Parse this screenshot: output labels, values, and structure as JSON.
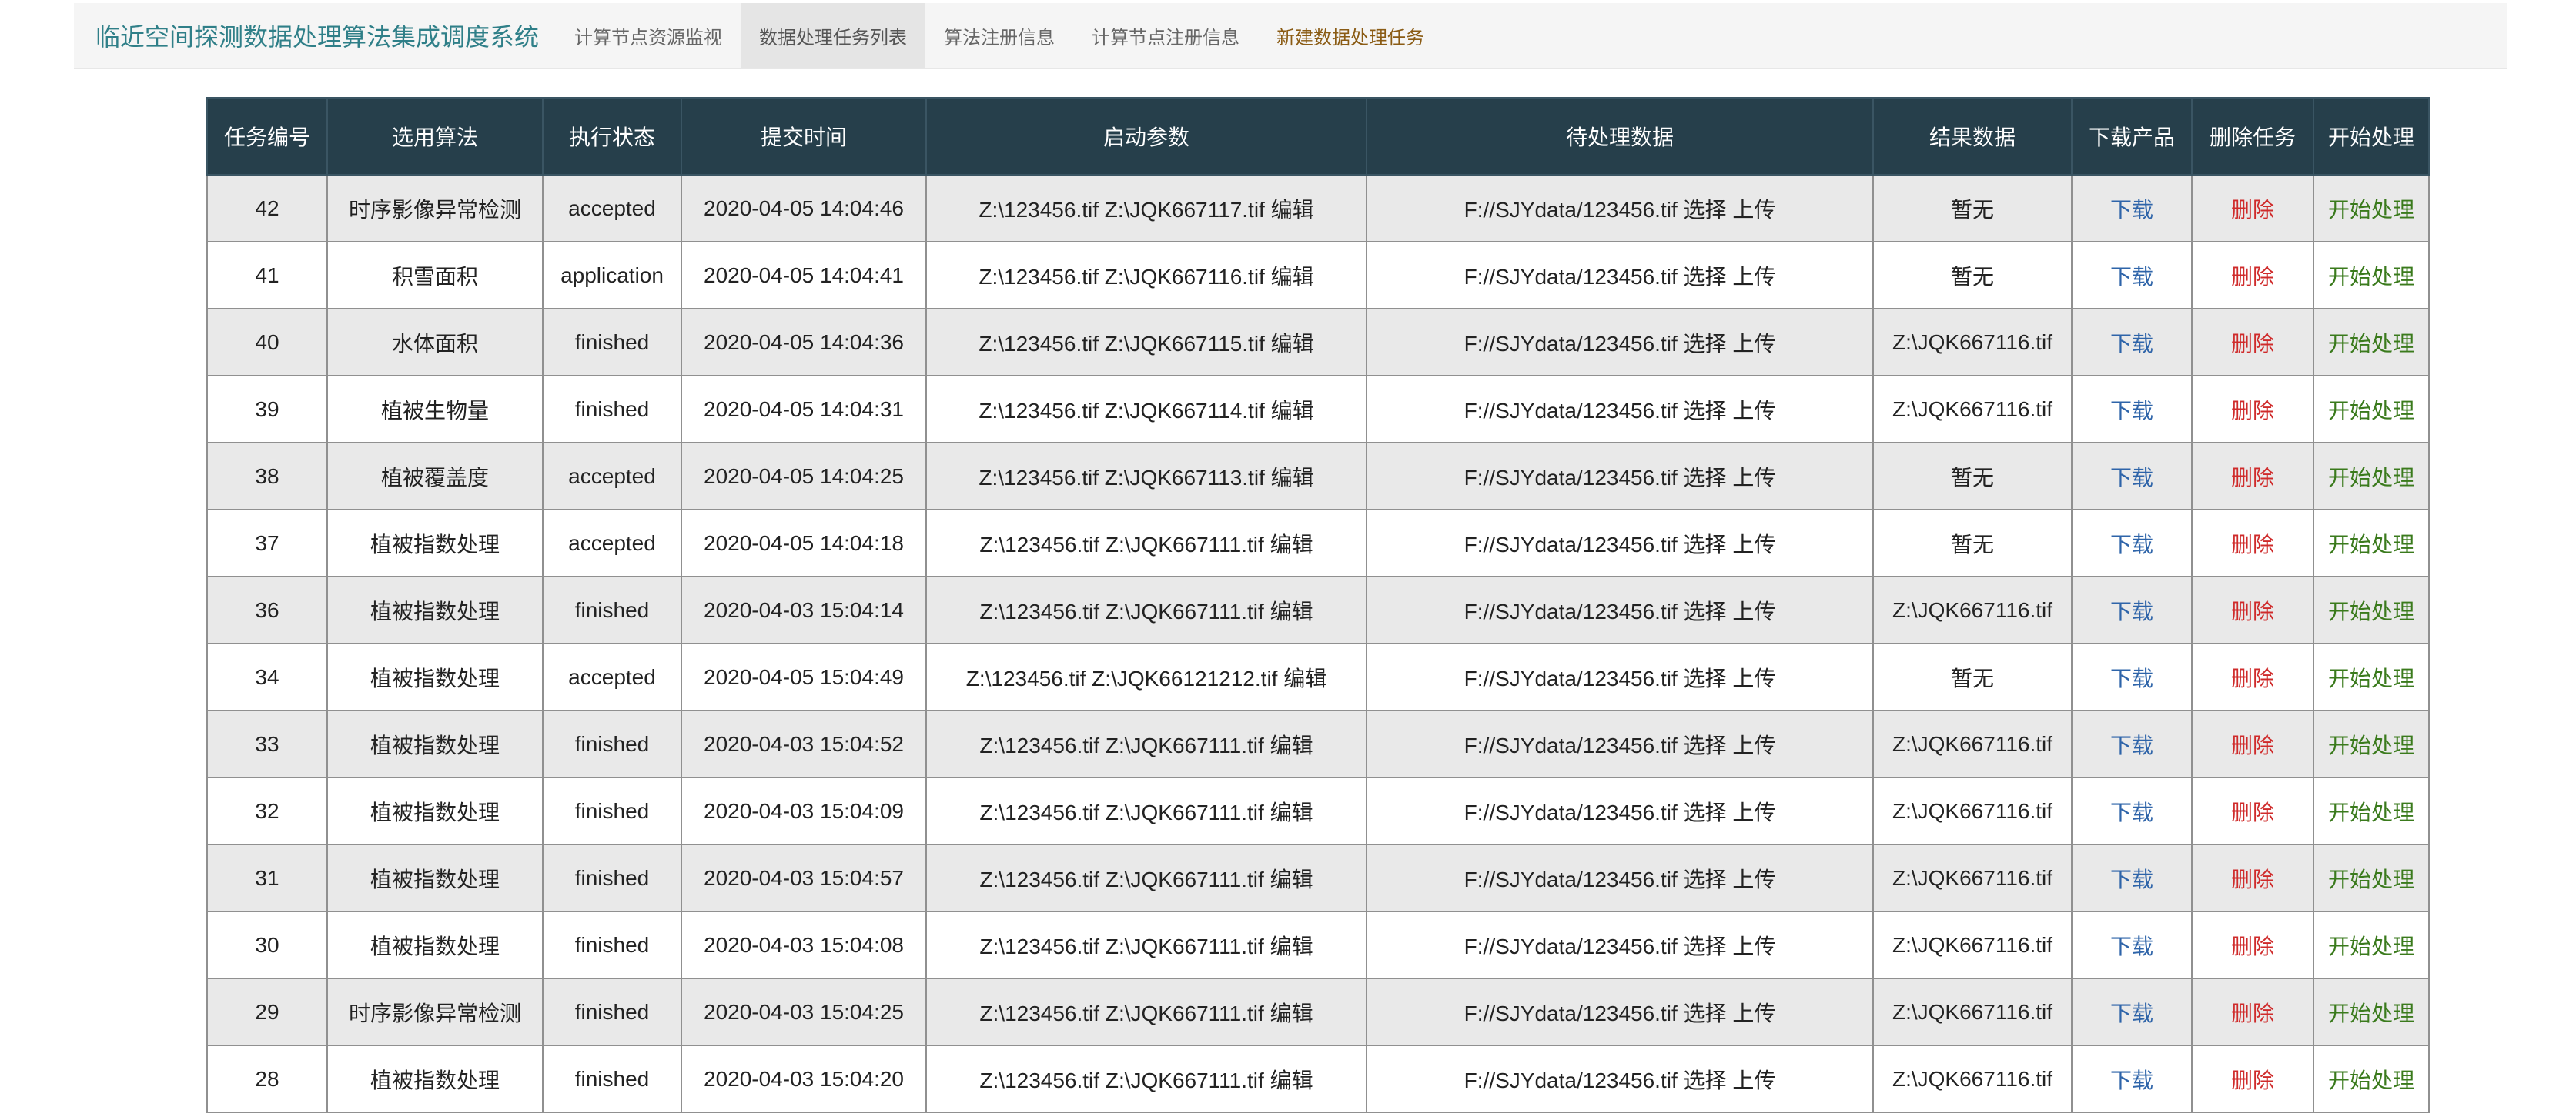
{
  "navbar": {
    "brand": "临近空间探测数据处理算法集成调度系统",
    "links": [
      {
        "label": "计算节点资源监视"
      },
      {
        "label": "数据处理任务列表"
      },
      {
        "label": "算法注册信息"
      },
      {
        "label": "计算节点注册信息"
      },
      {
        "label": "新建数据处理任务"
      }
    ]
  },
  "table": {
    "headers": [
      "任务编号",
      "选用算法",
      "执行状态",
      "提交时间",
      "启动参数",
      "待处理数据",
      "结果数据",
      "下载产品",
      "删除任务",
      "开始处理"
    ],
    "actions": {
      "edit": "编辑",
      "select": "选择",
      "upload": "上传",
      "download": "下载",
      "delete": "删除",
      "start": "开始处理"
    },
    "rows": [
      {
        "id": "42",
        "algorithm": "时序影像异常检测",
        "status": "accepted",
        "time": "2020-04-05 14:04:46",
        "params": "Z:\\123456.tif Z:\\JQK667117.tif",
        "input": "F://SJYdata/123456.tif",
        "result": "暂无"
      },
      {
        "id": "41",
        "algorithm": "积雪面积",
        "status": "application",
        "time": "2020-04-05 14:04:41",
        "params": "Z:\\123456.tif Z:\\JQK667116.tif",
        "input": "F://SJYdata/123456.tif",
        "result": "暂无"
      },
      {
        "id": "40",
        "algorithm": "水体面积",
        "status": "finished",
        "time": "2020-04-05 14:04:36",
        "params": "Z:\\123456.tif Z:\\JQK667115.tif",
        "input": "F://SJYdata/123456.tif",
        "result": "Z:\\JQK667116.tif"
      },
      {
        "id": "39",
        "algorithm": "植被生物量",
        "status": "finished",
        "time": "2020-04-05 14:04:31",
        "params": "Z:\\123456.tif Z:\\JQK667114.tif",
        "input": "F://SJYdata/123456.tif",
        "result": "Z:\\JQK667116.tif"
      },
      {
        "id": "38",
        "algorithm": "植被覆盖度",
        "status": "accepted",
        "time": "2020-04-05 14:04:25",
        "params": "Z:\\123456.tif Z:\\JQK667113.tif",
        "input": "F://SJYdata/123456.tif",
        "result": "暂无"
      },
      {
        "id": "37",
        "algorithm": "植被指数处理",
        "status": "accepted",
        "time": "2020-04-05 14:04:18",
        "params": "Z:\\123456.tif Z:\\JQK667111.tif",
        "input": "F://SJYdata/123456.tif",
        "result": "暂无"
      },
      {
        "id": "36",
        "algorithm": "植被指数处理",
        "status": "finished",
        "time": "2020-04-03 15:04:14",
        "params": "Z:\\123456.tif Z:\\JQK667111.tif",
        "input": "F://SJYdata/123456.tif",
        "result": "Z:\\JQK667116.tif"
      },
      {
        "id": "34",
        "algorithm": "植被指数处理",
        "status": "accepted",
        "time": "2020-04-05 15:04:49",
        "params": "Z:\\123456.tif Z:\\JQK66121212.tif",
        "input": "F://SJYdata/123456.tif",
        "result": "暂无"
      },
      {
        "id": "33",
        "algorithm": "植被指数处理",
        "status": "finished",
        "time": "2020-04-03 15:04:52",
        "params": "Z:\\123456.tif Z:\\JQK667111.tif",
        "input": "F://SJYdata/123456.tif",
        "result": "Z:\\JQK667116.tif"
      },
      {
        "id": "32",
        "algorithm": "植被指数处理",
        "status": "finished",
        "time": "2020-04-03 15:04:09",
        "params": "Z:\\123456.tif Z:\\JQK667111.tif",
        "input": "F://SJYdata/123456.tif",
        "result": "Z:\\JQK667116.tif"
      },
      {
        "id": "31",
        "algorithm": "植被指数处理",
        "status": "finished",
        "time": "2020-04-03 15:04:57",
        "params": "Z:\\123456.tif Z:\\JQK667111.tif",
        "input": "F://SJYdata/123456.tif",
        "result": "Z:\\JQK667116.tif"
      },
      {
        "id": "30",
        "algorithm": "植被指数处理",
        "status": "finished",
        "time": "2020-04-03 15:04:08",
        "params": "Z:\\123456.tif Z:\\JQK667111.tif",
        "input": "F://SJYdata/123456.tif",
        "result": "Z:\\JQK667116.tif"
      },
      {
        "id": "29",
        "algorithm": "时序影像异常检测",
        "status": "finished",
        "time": "2020-04-03 15:04:25",
        "params": "Z:\\123456.tif Z:\\JQK667111.tif",
        "input": "F://SJYdata/123456.tif",
        "result": "Z:\\JQK667116.tif"
      },
      {
        "id": "28",
        "algorithm": "植被指数处理",
        "status": "finished",
        "time": "2020-04-03 15:04:20",
        "params": "Z:\\123456.tif Z:\\JQK667111.tif",
        "input": "F://SJYdata/123456.tif",
        "result": "Z:\\JQK667116.tif"
      }
    ]
  },
  "colors": {
    "header_bg": "#263f4b",
    "brand": "#2f7f88",
    "download": "#2e64a9",
    "delete": "#cf2b2b",
    "start": "#3a7a1c",
    "stripe": "#e9e9e9"
  }
}
